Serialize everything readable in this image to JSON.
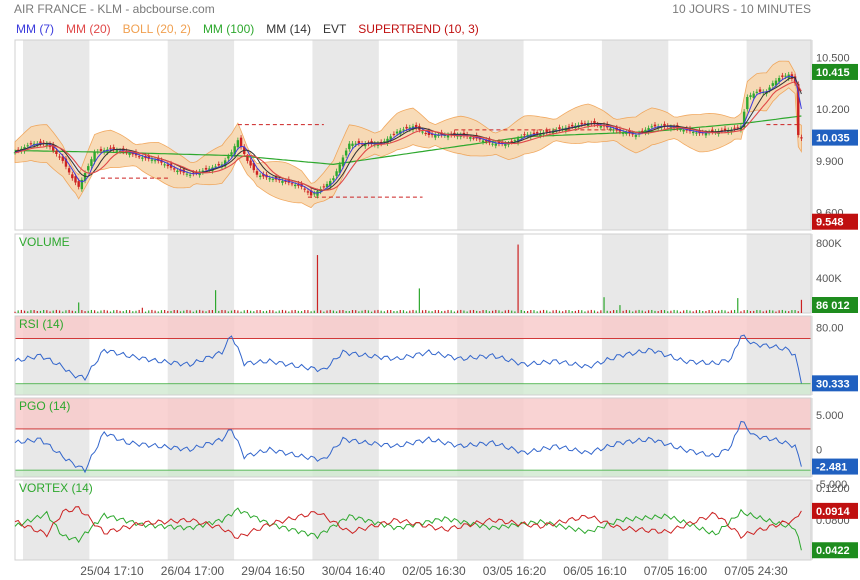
{
  "header": {
    "title": "AIR FRANCE - KLM - abcbourse.com",
    "period": "10 JOURS - 10 MINUTES"
  },
  "legend": [
    {
      "label": "MM (7)",
      "color": "#3b3bdd"
    },
    {
      "label": "MM (20)",
      "color": "#e04848"
    },
    {
      "label": "BOLL (20, 2)",
      "color": "#f0a050"
    },
    {
      "label": "MM (100)",
      "color": "#2ea82e"
    },
    {
      "label": "MM (14)",
      "color": "#333333"
    },
    {
      "label": "EVT",
      "color": "#333333"
    },
    {
      "label": "SUPERTREND (10, 3)",
      "color": "#c01010"
    }
  ],
  "colors": {
    "up": "#2ea82e",
    "down": "#cc2222",
    "band_fill": "#f8d8b0",
    "band_line": "#f0a050",
    "ma7": "#3b3bdd",
    "ma20": "#e04848",
    "ma100": "#2ea82e",
    "ma14": "#333333",
    "rsi": "#3366cc",
    "vortex_plus": "#2ea82e",
    "vortex_minus": "#cc2222",
    "shade": "#e8e8e8",
    "over_fill": "#f8c8c8",
    "under_fill": "#cfe8cf"
  },
  "chart_data": [
    {
      "name": "price",
      "type": "candlestick",
      "ylim": [
        9.5,
        10.6
      ],
      "yticks": [
        "10.500",
        "10.200",
        "9.900",
        "9.600"
      ],
      "badges": [
        {
          "label": "10.415",
          "value": 10.415,
          "color": "#1e8c1e"
        },
        {
          "label": "10.035",
          "value": 10.035,
          "color": "#2060c0"
        },
        {
          "label": "9.548",
          "value": 9.548,
          "color": "#c01010"
        }
      ],
      "close_points": [
        [
          0,
          9.95
        ],
        [
          5,
          10.0
        ],
        [
          10,
          10.0
        ],
        [
          15,
          9.9
        ],
        [
          18,
          9.8
        ],
        [
          20,
          9.75
        ],
        [
          25,
          9.95
        ],
        [
          30,
          9.97
        ],
        [
          35,
          9.95
        ],
        [
          40,
          9.92
        ],
        [
          45,
          9.9
        ],
        [
          50,
          9.85
        ],
        [
          55,
          9.82
        ],
        [
          60,
          9.85
        ],
        [
          65,
          9.88
        ],
        [
          68,
          9.95
        ],
        [
          70,
          10.02
        ],
        [
          73,
          9.9
        ],
        [
          76,
          9.82
        ],
        [
          80,
          9.8
        ],
        [
          85,
          9.78
        ],
        [
          90,
          9.75
        ],
        [
          93,
          9.7
        ],
        [
          97,
          9.75
        ],
        [
          100,
          9.8
        ],
        [
          105,
          10.0
        ],
        [
          110,
          10.0
        ],
        [
          115,
          10.0
        ],
        [
          120,
          10.07
        ],
        [
          125,
          10.1
        ],
        [
          130,
          10.05
        ],
        [
          135,
          10.05
        ],
        [
          140,
          10.05
        ],
        [
          145,
          10.03
        ],
        [
          150,
          10.0
        ],
        [
          155,
          10.0
        ],
        [
          160,
          10.05
        ],
        [
          165,
          10.06
        ],
        [
          170,
          10.08
        ],
        [
          175,
          10.1
        ],
        [
          180,
          10.12
        ],
        [
          185,
          10.1
        ],
        [
          190,
          10.07
        ],
        [
          195,
          10.05
        ],
        [
          200,
          10.1
        ],
        [
          205,
          10.1
        ],
        [
          210,
          10.08
        ],
        [
          215,
          10.06
        ],
        [
          220,
          10.07
        ],
        [
          225,
          10.08
        ],
        [
          228,
          10.1
        ],
        [
          230,
          10.27
        ],
        [
          233,
          10.3
        ],
        [
          236,
          10.3
        ],
        [
          238,
          10.35
        ],
        [
          240,
          10.38
        ],
        [
          243,
          10.4
        ],
        [
          245,
          10.35
        ],
        [
          246,
          10.05
        ],
        [
          247,
          10.03
        ]
      ],
      "ma100_points": [
        [
          0,
          9.96
        ],
        [
          30,
          9.95
        ],
        [
          70,
          9.93
        ],
        [
          100,
          9.88
        ],
        [
          130,
          9.96
        ],
        [
          160,
          10.04
        ],
        [
          200,
          10.07
        ],
        [
          230,
          10.12
        ],
        [
          247,
          10.16
        ]
      ],
      "supertrend_segments": [
        {
          "from": 27,
          "to": 49,
          "value": 9.8
        },
        {
          "from": 70,
          "to": 97,
          "value": 10.11
        },
        {
          "from": 92,
          "to": 128,
          "value": 9.69
        },
        {
          "from": 138,
          "to": 190,
          "value": 10.08
        },
        {
          "from": 236,
          "to": 247,
          "value": 10.11
        }
      ]
    },
    {
      "name": "volume",
      "type": "bar",
      "title": "VOLUME",
      "ylim": [
        0,
        900000
      ],
      "yticks": [
        "800K",
        "400K"
      ],
      "badges": [
        {
          "label": "86 012",
          "value": 86012,
          "color": "#1e8c1e"
        }
      ],
      "spikes": [
        {
          "x": 20,
          "value": 120000
        },
        {
          "x": 40,
          "value": 60000
        },
        {
          "x": 63,
          "value": 260000
        },
        {
          "x": 95,
          "value": 660000
        },
        {
          "x": 127,
          "value": 280000
        },
        {
          "x": 158,
          "value": 780000
        },
        {
          "x": 185,
          "value": 180000
        },
        {
          "x": 190,
          "value": 90000
        },
        {
          "x": 227,
          "value": 170000
        },
        {
          "x": 247,
          "value": 150000
        }
      ]
    },
    {
      "name": "rsi",
      "type": "line",
      "title": "RSI (14)",
      "ylim": [
        20,
        90
      ],
      "yticks": [
        "80.00",
        "30.00"
      ],
      "bands": {
        "upper": 70,
        "lower": 30
      },
      "badges": [
        {
          "label": "30.333",
          "value": 30.333,
          "color": "#2060c0"
        }
      ],
      "points": [
        [
          0,
          50
        ],
        [
          8,
          55
        ],
        [
          15,
          45
        ],
        [
          18,
          38
        ],
        [
          22,
          35
        ],
        [
          28,
          60
        ],
        [
          35,
          55
        ],
        [
          45,
          50
        ],
        [
          55,
          47
        ],
        [
          65,
          58
        ],
        [
          68,
          73
        ],
        [
          72,
          48
        ],
        [
          80,
          50
        ],
        [
          90,
          45
        ],
        [
          97,
          42
        ],
        [
          103,
          58
        ],
        [
          110,
          55
        ],
        [
          120,
          52
        ],
        [
          130,
          58
        ],
        [
          140,
          52
        ],
        [
          150,
          55
        ],
        [
          160,
          47
        ],
        [
          170,
          50
        ],
        [
          180,
          45
        ],
        [
          190,
          55
        ],
        [
          200,
          60
        ],
        [
          210,
          50
        ],
        [
          220,
          48
        ],
        [
          225,
          52
        ],
        [
          228,
          73
        ],
        [
          232,
          65
        ],
        [
          238,
          63
        ],
        [
          243,
          60
        ],
        [
          245,
          55
        ],
        [
          247,
          30.333
        ]
      ]
    },
    {
      "name": "pgo",
      "type": "line",
      "title": "PGO (14)",
      "ylim": [
        -4,
        7.5
      ],
      "yticks": [
        "5.000",
        "0",
        "-5.000"
      ],
      "bands": {
        "upper": 3,
        "lower": -3
      },
      "badges": [
        {
          "label": "-2.481",
          "value": -2.481,
          "color": "#2060c0"
        }
      ],
      "points": [
        [
          0,
          1
        ],
        [
          8,
          1.5
        ],
        [
          15,
          -1
        ],
        [
          18,
          -2
        ],
        [
          22,
          -3
        ],
        [
          28,
          2.5
        ],
        [
          35,
          1
        ],
        [
          45,
          0.5
        ],
        [
          55,
          0
        ],
        [
          65,
          1.5
        ],
        [
          68,
          3
        ],
        [
          72,
          -1
        ],
        [
          80,
          0
        ],
        [
          90,
          -1
        ],
        [
          97,
          -1.5
        ],
        [
          103,
          1.5
        ],
        [
          110,
          1
        ],
        [
          120,
          0.5
        ],
        [
          130,
          1.5
        ],
        [
          140,
          0.5
        ],
        [
          150,
          1
        ],
        [
          160,
          -0.5
        ],
        [
          170,
          0.5
        ],
        [
          180,
          -0.5
        ],
        [
          190,
          1
        ],
        [
          200,
          1.5
        ],
        [
          210,
          0
        ],
        [
          220,
          -1
        ],
        [
          225,
          0.5
        ],
        [
          228,
          4.2
        ],
        [
          232,
          2
        ],
        [
          238,
          1.5
        ],
        [
          243,
          0.8
        ],
        [
          245,
          0.5
        ],
        [
          247,
          -2.481
        ]
      ]
    },
    {
      "name": "vortex",
      "type": "line",
      "title": "VORTEX (14)",
      "ylim": [
        0.03,
        0.13
      ],
      "yticks": [
        "0.1200",
        "0.0800"
      ],
      "badges": [
        {
          "label": "0.0914",
          "value": 0.0914,
          "color": "#c01010"
        },
        {
          "label": "0.0422",
          "value": 0.0422,
          "color": "#1e8c1e"
        }
      ],
      "plus_points": [
        [
          0,
          0.072
        ],
        [
          10,
          0.088
        ],
        [
          15,
          0.06
        ],
        [
          20,
          0.055
        ],
        [
          28,
          0.086
        ],
        [
          40,
          0.074
        ],
        [
          55,
          0.07
        ],
        [
          65,
          0.08
        ],
        [
          70,
          0.093
        ],
        [
          80,
          0.075
        ],
        [
          95,
          0.06
        ],
        [
          105,
          0.085
        ],
        [
          120,
          0.07
        ],
        [
          135,
          0.082
        ],
        [
          150,
          0.07
        ],
        [
          165,
          0.078
        ],
        [
          180,
          0.065
        ],
        [
          190,
          0.08
        ],
        [
          205,
          0.085
        ],
        [
          220,
          0.062
        ],
        [
          228,
          0.09
        ],
        [
          240,
          0.075
        ],
        [
          245,
          0.07
        ],
        [
          247,
          0.0422
        ]
      ],
      "minus_points": [
        [
          0,
          0.078
        ],
        [
          10,
          0.062
        ],
        [
          15,
          0.09
        ],
        [
          20,
          0.095
        ],
        [
          28,
          0.064
        ],
        [
          40,
          0.076
        ],
        [
          55,
          0.08
        ],
        [
          65,
          0.07
        ],
        [
          70,
          0.058
        ],
        [
          80,
          0.075
        ],
        [
          95,
          0.09
        ],
        [
          105,
          0.065
        ],
        [
          120,
          0.08
        ],
        [
          135,
          0.068
        ],
        [
          150,
          0.08
        ],
        [
          165,
          0.072
        ],
        [
          180,
          0.085
        ],
        [
          190,
          0.07
        ],
        [
          205,
          0.065
        ],
        [
          220,
          0.088
        ],
        [
          228,
          0.06
        ],
        [
          240,
          0.075
        ],
        [
          245,
          0.08
        ],
        [
          247,
          0.0914
        ]
      ]
    }
  ],
  "x_axis": {
    "sessions": 11,
    "labels": [
      "25/04 17:10",
      "26/04 17:00",
      "29/04 16:50",
      "30/04 16:40",
      "02/05 16:30",
      "03/05 16:20",
      "06/05 16:10",
      "07/05 16:00",
      "07/05 24:30"
    ],
    "shaded_sessions": [
      0,
      2,
      4,
      6,
      8,
      10
    ]
  }
}
